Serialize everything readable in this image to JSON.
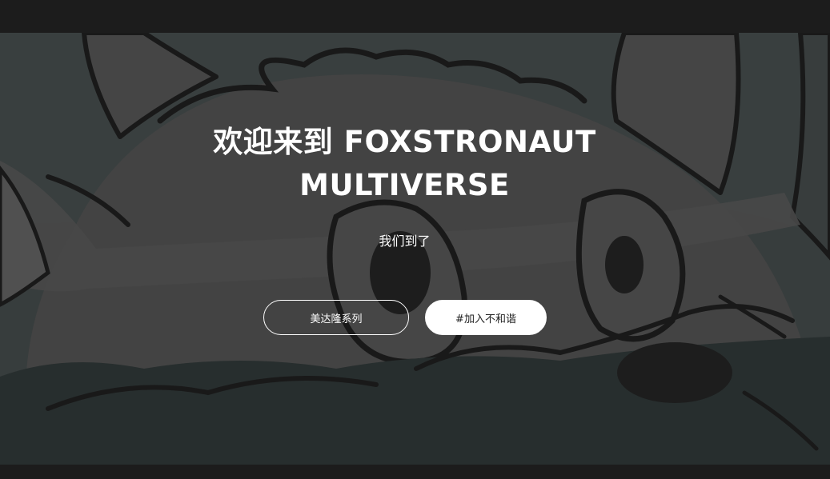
{
  "hero": {
    "title": "欢迎来到 FOXSTRONAUT MULTIVERSE",
    "subtitle": "我们到了",
    "buttons": {
      "collection_label": "美达隆系列",
      "join_label": "#加入不和谐"
    }
  },
  "colors": {
    "frame_bar": "#1c1c1c",
    "hero_background": "#3a4040",
    "text": "#ffffff",
    "solid_button_bg": "#ffffff",
    "solid_button_text": "#222222"
  },
  "icons": {
    "hero_artwork": "fox-character-illustration"
  }
}
